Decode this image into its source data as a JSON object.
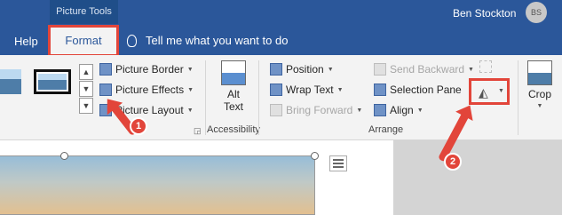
{
  "titlebar": {
    "context_tab_label": "Picture Tools",
    "user_name": "Ben Stockton",
    "user_initials": "BS"
  },
  "tabs": {
    "help": "Help",
    "format": "Format",
    "tell_me": "Tell me what you want to do"
  },
  "ribbon": {
    "picture_styles": {
      "picture_border": "Picture Border",
      "picture_effects": "Picture Effects",
      "picture_layout": "Picture Layout"
    },
    "accessibility": {
      "alt_text_line1": "Alt",
      "alt_text_line2": "Text",
      "label": "Accessibility"
    },
    "arrange": {
      "position": "Position",
      "wrap_text": "Wrap Text",
      "bring_forward": "Bring Forward",
      "send_backward": "Send Backward",
      "selection_pane": "Selection Pane",
      "align": "Align",
      "label": "Arrange"
    },
    "size": {
      "crop": "Crop"
    }
  },
  "callouts": {
    "step1": "1",
    "step2": "2"
  },
  "colors": {
    "titlebar": "#2b579a",
    "highlight_red": "#e2453a",
    "ribbon_bg": "#f3f3f3"
  },
  "icons": [
    "lightbulb-icon",
    "picture-border-icon",
    "picture-effects-icon",
    "picture-layout-icon",
    "alt-text-icon",
    "position-icon",
    "wrap-text-icon",
    "bring-forward-icon",
    "send-backward-icon",
    "selection-pane-icon",
    "align-icon",
    "rotate-icon",
    "crop-icon",
    "layout-options-icon"
  ]
}
